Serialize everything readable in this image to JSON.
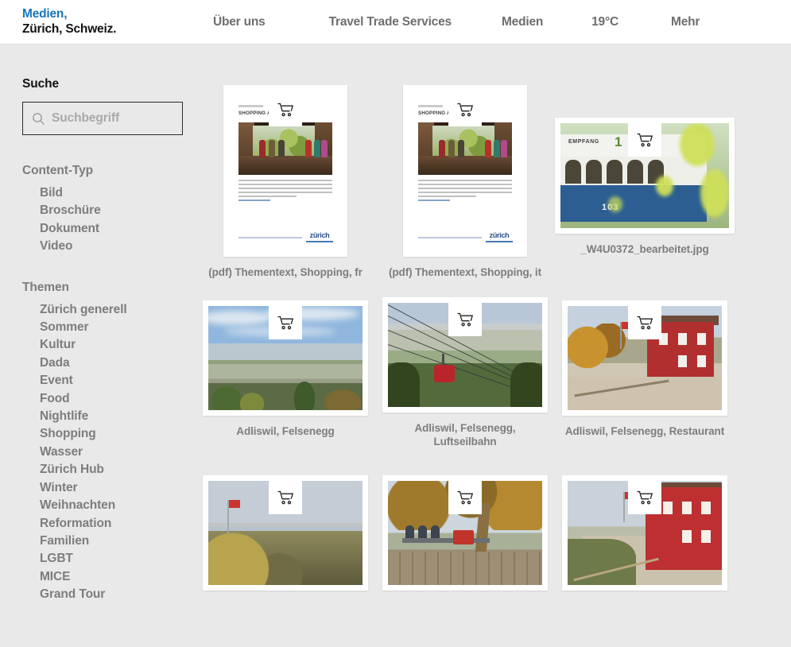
{
  "header": {
    "brand_line1": "Medien,",
    "brand_line2": "Zürich, Schweiz.",
    "brand_color": "#1675b8",
    "nav": [
      {
        "label": "Über uns"
      },
      {
        "label": "Travel Trade Services"
      },
      {
        "label": "Medien"
      },
      {
        "label": "19°C"
      },
      {
        "label": "Mehr"
      }
    ]
  },
  "sidebar": {
    "search": {
      "heading": "Suche",
      "placeholder": "Suchbegriff",
      "value": "",
      "icon": "search-icon"
    },
    "facets": [
      {
        "title": "Content-Typ",
        "items": [
          "Bild",
          "Broschüre",
          "Dokument",
          "Video"
        ]
      },
      {
        "title": "Themen",
        "items": [
          "Zürich generell",
          "Sommer",
          "Kultur",
          "Dada",
          "Event",
          "Food",
          "Nightlife",
          "Shopping",
          "Wasser",
          "Zürich Hub",
          "Winter",
          "Weihnachten",
          "Reformation",
          "Familien",
          "LGBT",
          "MICE",
          "Grand Tour"
        ]
      }
    ]
  },
  "results": {
    "cart_icon": "shopping-cart-icon",
    "rows": [
      {
        "items": [
          {
            "kind": "document",
            "caption": "(pdf) Thementext, Shopping, fr",
            "doc_title": "SHOPPING À ZUR",
            "doc_logo": "zürich"
          },
          {
            "kind": "document",
            "caption": "(pdf) Thementext, Shopping, it",
            "doc_title": "SHOPPING A ZUR",
            "doc_logo": "zürich"
          },
          {
            "kind": "image",
            "caption": "_W4U0372_bearbeitet.jpg",
            "alt_text": "EMPFANG 1 — Tram 103"
          }
        ]
      },
      {
        "items": [
          {
            "kind": "image",
            "caption": "Adliswil, Felsenegg"
          },
          {
            "kind": "image",
            "caption": "Adliswil, Felsenegg, Luftseilbahn"
          },
          {
            "kind": "image",
            "caption": "Adliswil, Felsenegg, Restaurant"
          }
        ]
      },
      {
        "items": [
          {
            "kind": "image",
            "caption": ""
          },
          {
            "kind": "image",
            "caption": ""
          },
          {
            "kind": "image",
            "caption": ""
          }
        ]
      }
    ]
  },
  "tram_photo": {
    "sign_text": "EMPFANG",
    "line_number": "1",
    "car_number": "103"
  }
}
